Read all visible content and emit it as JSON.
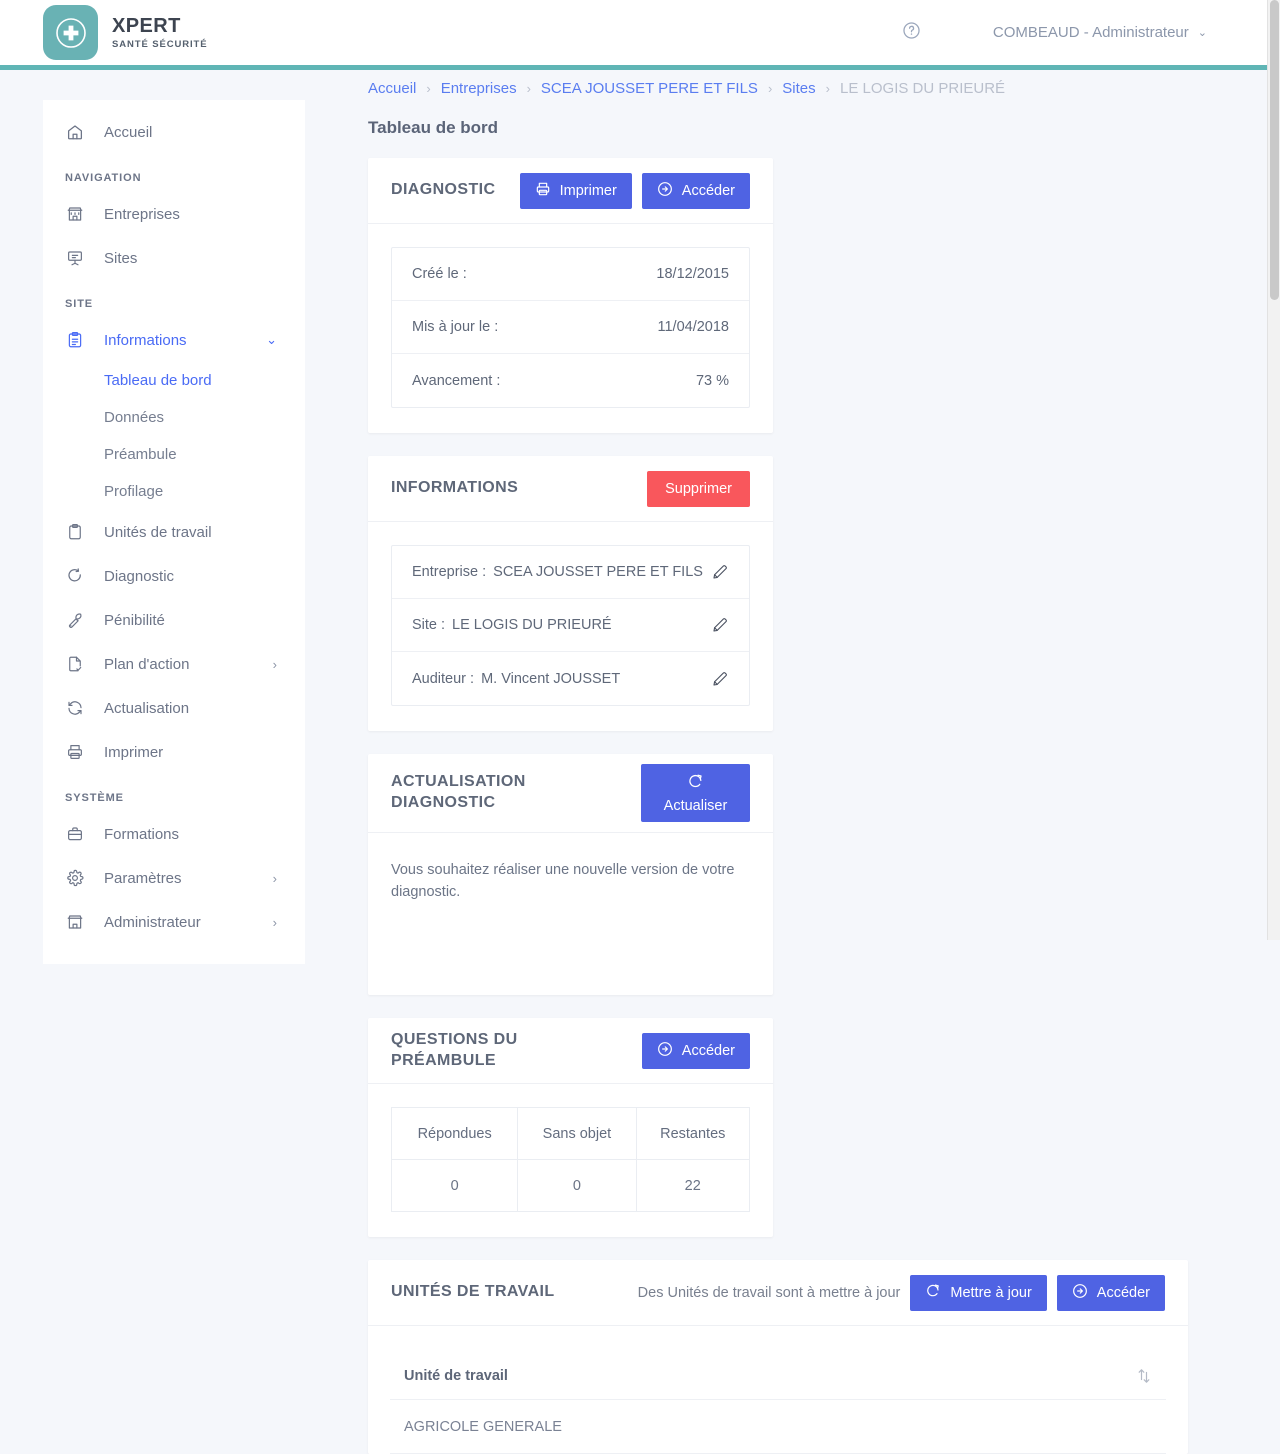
{
  "header": {
    "brand_title": "XPERT",
    "brand_subtitle": "SANTÉ SÉCURITÉ",
    "help_icon": "help-circle-icon",
    "user_label": "COMBEAUD - Administrateur",
    "user_caret": "⌄",
    "accent_teal": "#69b2b4"
  },
  "breadcrumb": {
    "items": [
      {
        "label": "Accueil",
        "current": false
      },
      {
        "label": "Entreprises",
        "current": false
      },
      {
        "label": "SCEA JOUSSET PERE ET FILS",
        "current": false
      },
      {
        "label": "Sites",
        "current": false
      },
      {
        "label": "LE LOGIS DU PRIEURÉ",
        "current": true
      }
    ],
    "separator": "›"
  },
  "page": {
    "title": "Tableau de bord"
  },
  "sidebar": {
    "home": {
      "label": "Accueil",
      "icon": "home-icon"
    },
    "section_navigation": "NAVIGATION",
    "navigation_items": [
      {
        "label": "Entreprises",
        "icon": "store-icon"
      },
      {
        "label": "Sites",
        "icon": "presentation-icon"
      }
    ],
    "section_site": "SITE",
    "informations": {
      "label": "Informations",
      "icon": "clipboard-list-icon",
      "chevron": "⌄"
    },
    "informations_children": [
      {
        "label": "Tableau de bord",
        "active": true
      },
      {
        "label": "Données",
        "active": false
      },
      {
        "label": "Préambule",
        "active": false
      },
      {
        "label": "Profilage",
        "active": false
      }
    ],
    "site_items": [
      {
        "label": "Unités de travail",
        "icon": "clipboard-icon",
        "chevron": ""
      },
      {
        "label": "Diagnostic",
        "icon": "refresh-circle-icon",
        "chevron": ""
      },
      {
        "label": "Pénibilité",
        "icon": "wrench-icon",
        "chevron": ""
      },
      {
        "label": "Plan d'action",
        "icon": "document-check-icon",
        "chevron": "›"
      },
      {
        "label": "Actualisation",
        "icon": "refresh-icon",
        "chevron": ""
      },
      {
        "label": "Imprimer",
        "icon": "printer-icon",
        "chevron": ""
      }
    ],
    "section_system": "SYSTÈME",
    "system_items": [
      {
        "label": "Formations",
        "icon": "briefcase-icon",
        "chevron": ""
      },
      {
        "label": "Paramètres",
        "icon": "gear-icon",
        "chevron": "›"
      },
      {
        "label": "Administrateur",
        "icon": "store-icon",
        "chevron": "›"
      }
    ]
  },
  "cards": {
    "diagnostic": {
      "title": "DIAGNOSTIC",
      "print_label": "Imprimer",
      "access_label": "Accéder",
      "rows": [
        {
          "key": "Créé le :",
          "value": "18/12/2015"
        },
        {
          "key": "Mis à jour le :",
          "value": "11/04/2018"
        },
        {
          "key": "Avancement :",
          "value": "73 %"
        }
      ]
    },
    "informations": {
      "title": "INFORMATIONS",
      "delete_label": "Supprimer",
      "rows": [
        {
          "key": "Entreprise :",
          "value": "SCEA JOUSSET PERE ET FILS"
        },
        {
          "key": "Site :",
          "value": "LE LOGIS DU PRIEURÉ"
        },
        {
          "key": "Auditeur :",
          "value": "M. Vincent JOUSSET"
        }
      ]
    },
    "actualisation": {
      "title_line1": "ACTUALISATION",
      "title_line2": "DIAGNOSTIC",
      "refresh_label": "Actualiser",
      "note": "Vous souhaitez réaliser une nouvelle version de votre diagnostic."
    },
    "questions": {
      "title": "QUESTIONS DU PRÉAMBULE",
      "access_label": "Accéder",
      "headers": [
        "Répondues",
        "Sans objet",
        "Restantes"
      ],
      "values": [
        "0",
        "0",
        "22"
      ]
    },
    "unites": {
      "title": "UNITÉS DE TRAVAIL",
      "note": "Des Unités de travail sont à mettre à jour",
      "update_label": "Mettre à jour",
      "access_label": "Accéder",
      "column_header": "Unité de travail",
      "rows": [
        "AGRICOLE GENERALE"
      ]
    }
  },
  "colors": {
    "primary": "#4f63e3",
    "danger": "#f9575c",
    "teal": "#69b2b4",
    "link": "#5a7df0"
  }
}
